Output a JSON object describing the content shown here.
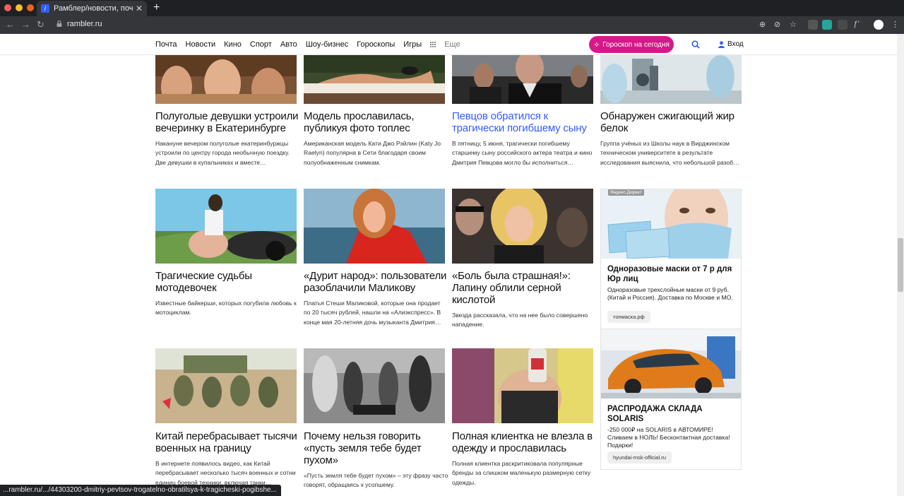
{
  "browser": {
    "tab_title": "Рамблер/новости, почта",
    "tab_icon": "rambler-favicon",
    "url": "rambler.ru",
    "status_url": "...rambler.ru/.../44303200-dmitriy-pevtsov-trogatelno-obratilsya-k-tragicheski-pogibshe..."
  },
  "header": {
    "nav": [
      "Почта",
      "Новости",
      "Кино",
      "Спорт",
      "Авто",
      "Шоу-бизнес",
      "Гороскопы",
      "Игры"
    ],
    "more": "Еще",
    "horoscope_button": "Гороскоп на сегодня",
    "login": "Вход",
    "accent": "#d61889",
    "link_color": "#315efb"
  },
  "rows": [
    {
      "cards": [
        {
          "title": "Полуголые девушки устроили вечеринку в Екатеринбурге",
          "lead": "Накануне вечером полуголые екатеринбуржцы устроили по центру города необычную поездку. Две девушки в купальниках и вместе…"
        },
        {
          "title": "Модель прославилась, публикуя фото топлес",
          "lead": "Американская модель Кати Джо Рэйлин (Katy Jo Raelyn) популярна в Сети благодаря своим полуобнаженным снимкам."
        },
        {
          "title": "Певцов обратился к трагически погибшему сыну",
          "lead": "В пятницу, 5 июня, трагически погибшему старшему сыну российского актера театра и кино Дмитрия Певцова могло бы исполниться…",
          "hovered": true
        },
        {
          "title": "Обнаружен сжигающий жир белок",
          "lead": "Группа учёных из Школы наук в Вирджинском техническом университете в результате исследования выяснила, что небольшой разоб…"
        }
      ]
    },
    {
      "cards": [
        {
          "title": "Трагические судьбы мотодевочек",
          "lead": "Известные байкерши, которых погубила любовь к мотоциклам."
        },
        {
          "title": "«Дурит народ»: пользователи разоблачили Маликову",
          "lead": "Платья Стеши Маликовой, которые она продает по 20 тысяч рублей, нашли на «Алиэкспресс». В конце мая 20-летняя дочь музыканта Дмитрия…"
        },
        {
          "title": "«Боль была страшная!»: Лапину облили серной кислотой",
          "lead": "Звезда рассказала, что на нее было совершено нападение."
        }
      ]
    },
    {
      "cards": [
        {
          "title": "Китай перебрасывает тысячи военных на границу",
          "lead": "В интернете появилось видео, как Китай перебрасывает несколько тысяч военных и сотни единиц боевой техники, включая танки…"
        },
        {
          "title": "Почему нельзя говорить «пусть земля тебе будет пухом»",
          "lead": "«Пусть земля тебе будет пухом» – эту фразу часто говорят, обращаясь к усопшему."
        },
        {
          "title": "Полная клиентка не влезла в одежду и прославилась",
          "lead": "Полная клиентка раскритиковала популярные бренды за слишком маленькую размерную сетку одежды."
        }
      ]
    }
  ],
  "ads": [
    {
      "tag": "Яндекс.Директ",
      "title": "Одноразовые маски от 7 р для Юр лиц",
      "text": "Одноразовые трехслойные маски от 9 руб. (Китай и Россия). Доставка по Москве и МО.",
      "domain": "топмаска.рф"
    },
    {
      "title": "РАСПРОДАЖА СКЛАДА SOLARIS",
      "text": "-250 000₽ на SOLARIS в АВТОМИРЕ! Сливаем в НОЛЬ! Бесконтактная доставка! Подарки!",
      "domain": "hyundai-msk-official.ru"
    }
  ]
}
